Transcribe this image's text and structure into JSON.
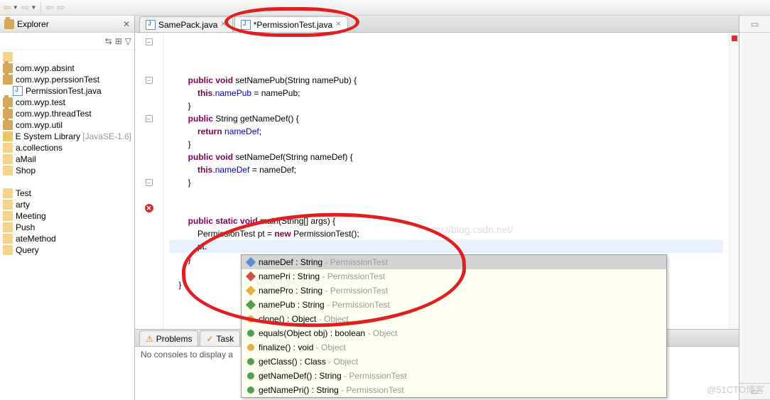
{
  "toolbar": {
    "arrows": [
      "◀",
      "▶",
      "◀",
      "▶"
    ]
  },
  "sidebar": {
    "title": "Explorer",
    "items": [
      {
        "label": "",
        "icon": "folder"
      },
      {
        "label": "com.wyp.absint",
        "icon": "pkg"
      },
      {
        "label": "com.wyp.perssionTest",
        "icon": "pkg"
      },
      {
        "label": "PermissionTest.java",
        "icon": "java",
        "indent": 1
      },
      {
        "label": "com.wyp.test",
        "icon": "pkg"
      },
      {
        "label": "com.wyp.threadTest",
        "icon": "pkg"
      },
      {
        "label": "com.wyp.util",
        "icon": "pkg"
      },
      {
        "label": "E System Library",
        "suffix": " [JavaSE-1.6]",
        "icon": "lib"
      },
      {
        "label": "a.collections",
        "icon": "folder"
      },
      {
        "label": "aMail",
        "icon": "folder"
      },
      {
        "label": "Shop",
        "icon": "folder"
      },
      {
        "label": "",
        "icon": ""
      },
      {
        "label": "Test",
        "icon": "folder"
      },
      {
        "label": "arty",
        "icon": "folder"
      },
      {
        "label": "Meeting",
        "icon": "folder"
      },
      {
        "label": "Push",
        "icon": "folder"
      },
      {
        "label": "ateMethod",
        "icon": "folder"
      },
      {
        "label": "Query",
        "icon": "folder"
      }
    ]
  },
  "tabs": [
    {
      "label": "SamePack.java",
      "active": false
    },
    {
      "label": "*PermissionTest.java",
      "active": true
    }
  ],
  "code": {
    "watermark": "http://blog.csdn.net/",
    "lines": [
      {
        "indent": 2,
        "tokens": [
          [
            "kw",
            "public"
          ],
          [
            "",
            ""
          ],
          [
            "kw",
            " void"
          ],
          [
            "",
            " setNamePub(String namePub) {"
          ]
        ],
        "gutter": "fold"
      },
      {
        "indent": 3,
        "tokens": [
          [
            "kw",
            "this"
          ],
          [
            "",
            "."
          ],
          [
            "field",
            "namePub"
          ],
          [
            "",
            " = namePub;"
          ]
        ]
      },
      {
        "indent": 2,
        "tokens": [
          [
            "",
            "}"
          ]
        ]
      },
      {
        "indent": 2,
        "tokens": [
          [
            "kw",
            "public"
          ],
          [
            "",
            " String getNameDef() {"
          ]
        ],
        "gutter": "fold"
      },
      {
        "indent": 3,
        "tokens": [
          [
            "kw",
            "return"
          ],
          [
            "",
            " "
          ],
          [
            "field",
            "nameDef"
          ],
          [
            "",
            ";"
          ]
        ]
      },
      {
        "indent": 2,
        "tokens": [
          [
            "",
            "}"
          ]
        ]
      },
      {
        "indent": 2,
        "tokens": [
          [
            "kw",
            "public"
          ],
          [
            "",
            ""
          ],
          [
            "kw",
            " void"
          ],
          [
            "",
            " setNameDef(String nameDef) {"
          ]
        ],
        "gutter": "fold"
      },
      {
        "indent": 3,
        "tokens": [
          [
            "kw",
            "this"
          ],
          [
            "",
            "."
          ],
          [
            "field",
            "nameDef"
          ],
          [
            "",
            " = nameDef;"
          ]
        ]
      },
      {
        "indent": 2,
        "tokens": [
          [
            "",
            "}"
          ]
        ]
      },
      {
        "indent": 0,
        "tokens": [
          [
            "",
            ""
          ]
        ]
      },
      {
        "indent": 0,
        "tokens": [
          [
            "",
            ""
          ]
        ]
      },
      {
        "indent": 2,
        "tokens": [
          [
            "kw",
            "public"
          ],
          [
            "",
            ""
          ],
          [
            "kw",
            " static"
          ],
          [
            "",
            ""
          ],
          [
            "kw",
            " void"
          ],
          [
            "",
            " main(String[] args) {"
          ]
        ],
        "gutter": "fold"
      },
      {
        "indent": 3,
        "tokens": [
          [
            "",
            "PermissionTest pt = "
          ],
          [
            "kw",
            "new"
          ],
          [
            "",
            " PermissionTest();"
          ]
        ]
      },
      {
        "indent": 3,
        "tokens": [
          [
            "",
            "pt."
          ]
        ],
        "gutter": "error",
        "current": true
      },
      {
        "indent": 2,
        "tokens": [
          [
            "",
            "}"
          ]
        ]
      },
      {
        "indent": 0,
        "tokens": [
          [
            "",
            ""
          ]
        ]
      },
      {
        "indent": 1,
        "tokens": [
          [
            "",
            "}"
          ]
        ]
      }
    ]
  },
  "completion": [
    {
      "icon": "default",
      "name": "nameDef",
      "type": ": String",
      "source": "PermissionTest",
      "selected": true
    },
    {
      "icon": "private",
      "name": "namePri",
      "type": ": String",
      "source": "PermissionTest"
    },
    {
      "icon": "protected",
      "name": "namePro",
      "type": ": String",
      "source": "PermissionTest"
    },
    {
      "icon": "public",
      "name": "namePub",
      "type": ": String",
      "source": "PermissionTest"
    },
    {
      "icon": "method-prot",
      "name": "clone()",
      "type": ": Object",
      "source": "Object"
    },
    {
      "icon": "method-pub",
      "name": "equals(Object obj)",
      "type": ": boolean",
      "source": "Object"
    },
    {
      "icon": "method-prot",
      "name": "finalize()",
      "type": ": void",
      "source": "Object"
    },
    {
      "icon": "method-pub",
      "name": "getClass()",
      "type": ": Class<?>",
      "source": "Object"
    },
    {
      "icon": "method-pub",
      "name": "getNameDef()",
      "type": ": String",
      "source": "PermissionTest"
    },
    {
      "icon": "method-pub",
      "name": "getNamePri()",
      "type": ": String",
      "source": "PermissionTest"
    }
  ],
  "bottom": {
    "tabs": [
      "Problems",
      "Task"
    ],
    "content": "No consoles to display a"
  },
  "footer_watermark": "@51CTO博客"
}
